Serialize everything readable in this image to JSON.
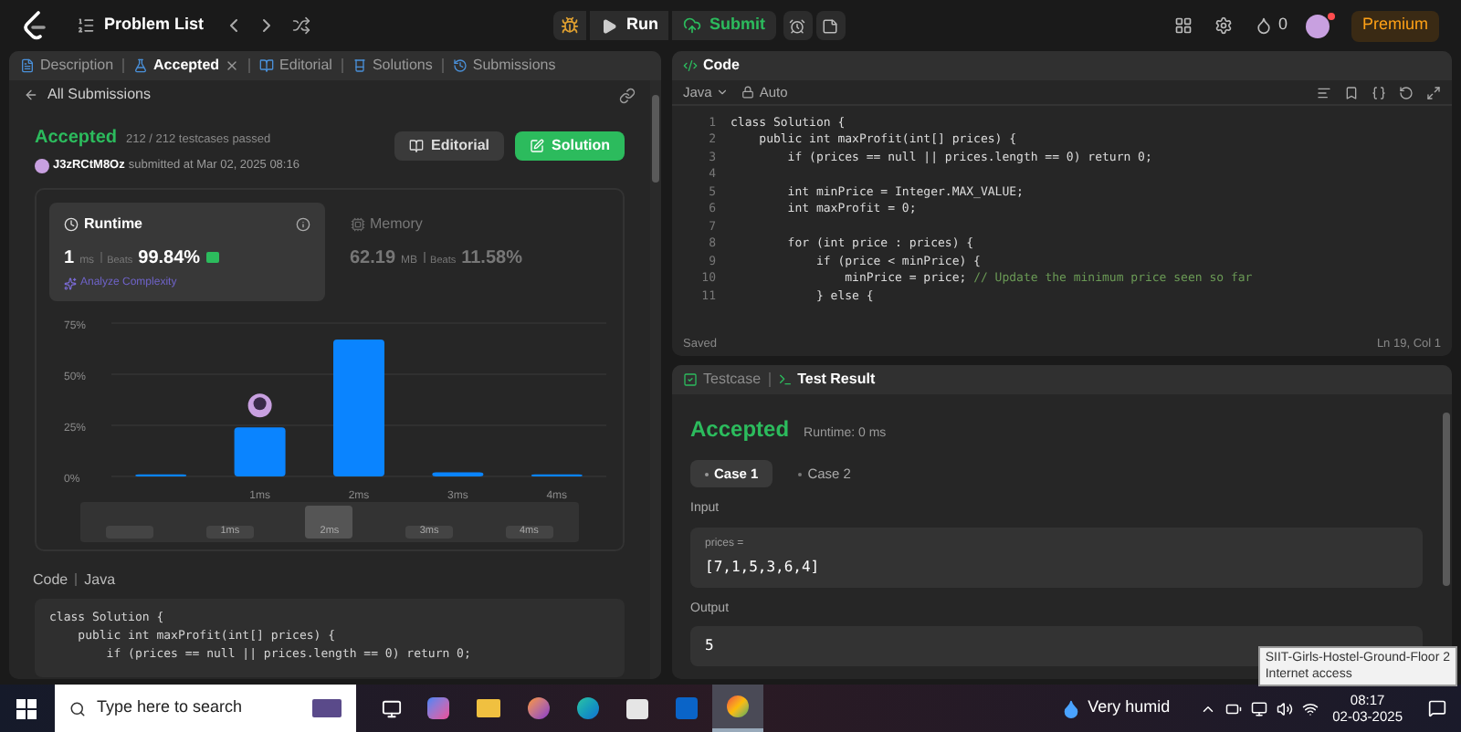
{
  "topbar": {
    "problem_list": "Problem List",
    "run": "Run",
    "submit": "Submit",
    "streak": "0",
    "premium": "Premium"
  },
  "left_tabs": [
    {
      "label": "Description",
      "selected": false,
      "closable": false
    },
    {
      "label": "Accepted",
      "selected": true,
      "closable": true
    },
    {
      "label": "Editorial",
      "selected": false,
      "closable": false
    },
    {
      "label": "Solutions",
      "selected": false,
      "closable": false
    },
    {
      "label": "Submissions",
      "selected": false,
      "closable": false
    }
  ],
  "submission": {
    "back": "All Submissions",
    "status": "Accepted",
    "testcases": "212 / 212 testcases passed",
    "user": "J3zRCtM8Oz",
    "submitted": "submitted at Mar 02, 2025 08:16",
    "editorial": "Editorial",
    "solution": "Solution"
  },
  "stats": [
    {
      "kind": "runtime",
      "title": "Runtime",
      "value": "1",
      "unit": "ms",
      "beats_label": "Beats",
      "beats": "99.84%",
      "selected": true,
      "link": "Analyze Complexity"
    },
    {
      "kind": "memory",
      "title": "Memory",
      "value": "62.19",
      "unit": "MB",
      "beats_label": "Beats",
      "beats": "11.58%",
      "selected": false
    }
  ],
  "distribution": {
    "chart_data": {
      "type": "bar",
      "categories": [
        null,
        "1ms",
        "2ms",
        "3ms",
        "4ms"
      ],
      "values": [
        1,
        24,
        67,
        2,
        1
      ],
      "ylim": [
        0,
        75
      ],
      "yticks": [
        {
          "value": 0,
          "label": "0%"
        },
        {
          "value": 25,
          "label": "25%"
        },
        {
          "value": 50,
          "label": "50%"
        },
        {
          "value": 75,
          "label": "75%"
        }
      ]
    },
    "navigator": [
      {
        "selected": false
      },
      {
        "label": "1ms",
        "selected": false
      },
      {
        "label": "2ms",
        "selected": true
      },
      {
        "label": "3ms",
        "selected": false
      },
      {
        "label": "4ms",
        "selected": false
      }
    ]
  },
  "code_section": {
    "label": "Code",
    "language": "Java",
    "lines": [
      "class Solution {",
      "    public int maxProfit(int[] prices) {",
      "        if (prices == null || prices.length == 0) return 0;"
    ]
  },
  "editor": {
    "title": "Code",
    "language": "Java",
    "mode": "Auto",
    "lines": [
      {
        "n": "1",
        "code": "class Solution {"
      },
      {
        "n": "2",
        "code": "    public int maxProfit(int[] prices) {"
      },
      {
        "n": "3",
        "code": "        if (prices == null || prices.length == 0) return 0;"
      },
      {
        "n": "4"
      },
      {
        "n": "5",
        "code": "        int minPrice = Integer.MAX_VALUE;"
      },
      {
        "n": "6",
        "code": "        int maxProfit = 0;"
      },
      {
        "n": "7"
      },
      {
        "n": "8",
        "code": "        for (int price : prices) {"
      },
      {
        "n": "9",
        "code": "            if (price < minPrice) {"
      },
      {
        "n": "10",
        "code": "                minPrice = price; ",
        "comment": "// Update the minimum price seen so far"
      },
      {
        "n": "11",
        "code": "            } else {"
      }
    ],
    "status": "Saved",
    "cursor": "Ln 19, Col 1"
  },
  "result": {
    "tabs": [
      {
        "label": "Testcase",
        "selected": false
      },
      {
        "label": "Test Result",
        "selected": true
      }
    ],
    "status": "Accepted",
    "runtime": "Runtime: 0 ms",
    "cases": [
      {
        "label": "Case 1",
        "selected": true
      },
      {
        "label": "Case 2",
        "selected": false
      }
    ],
    "input_label": "Input",
    "input_name": "prices =",
    "input_value": "[7,1,5,3,6,4]",
    "output_label": "Output",
    "output_value": "5"
  },
  "taskbar": {
    "search_placeholder": "Type here to search",
    "weather": "Very humid",
    "time": "08:17",
    "date": "02-03-2025"
  },
  "tooltip": {
    "title": "SIIT-Girls-Hostel-Ground-Floor 2",
    "subtitle": "Internet access"
  }
}
